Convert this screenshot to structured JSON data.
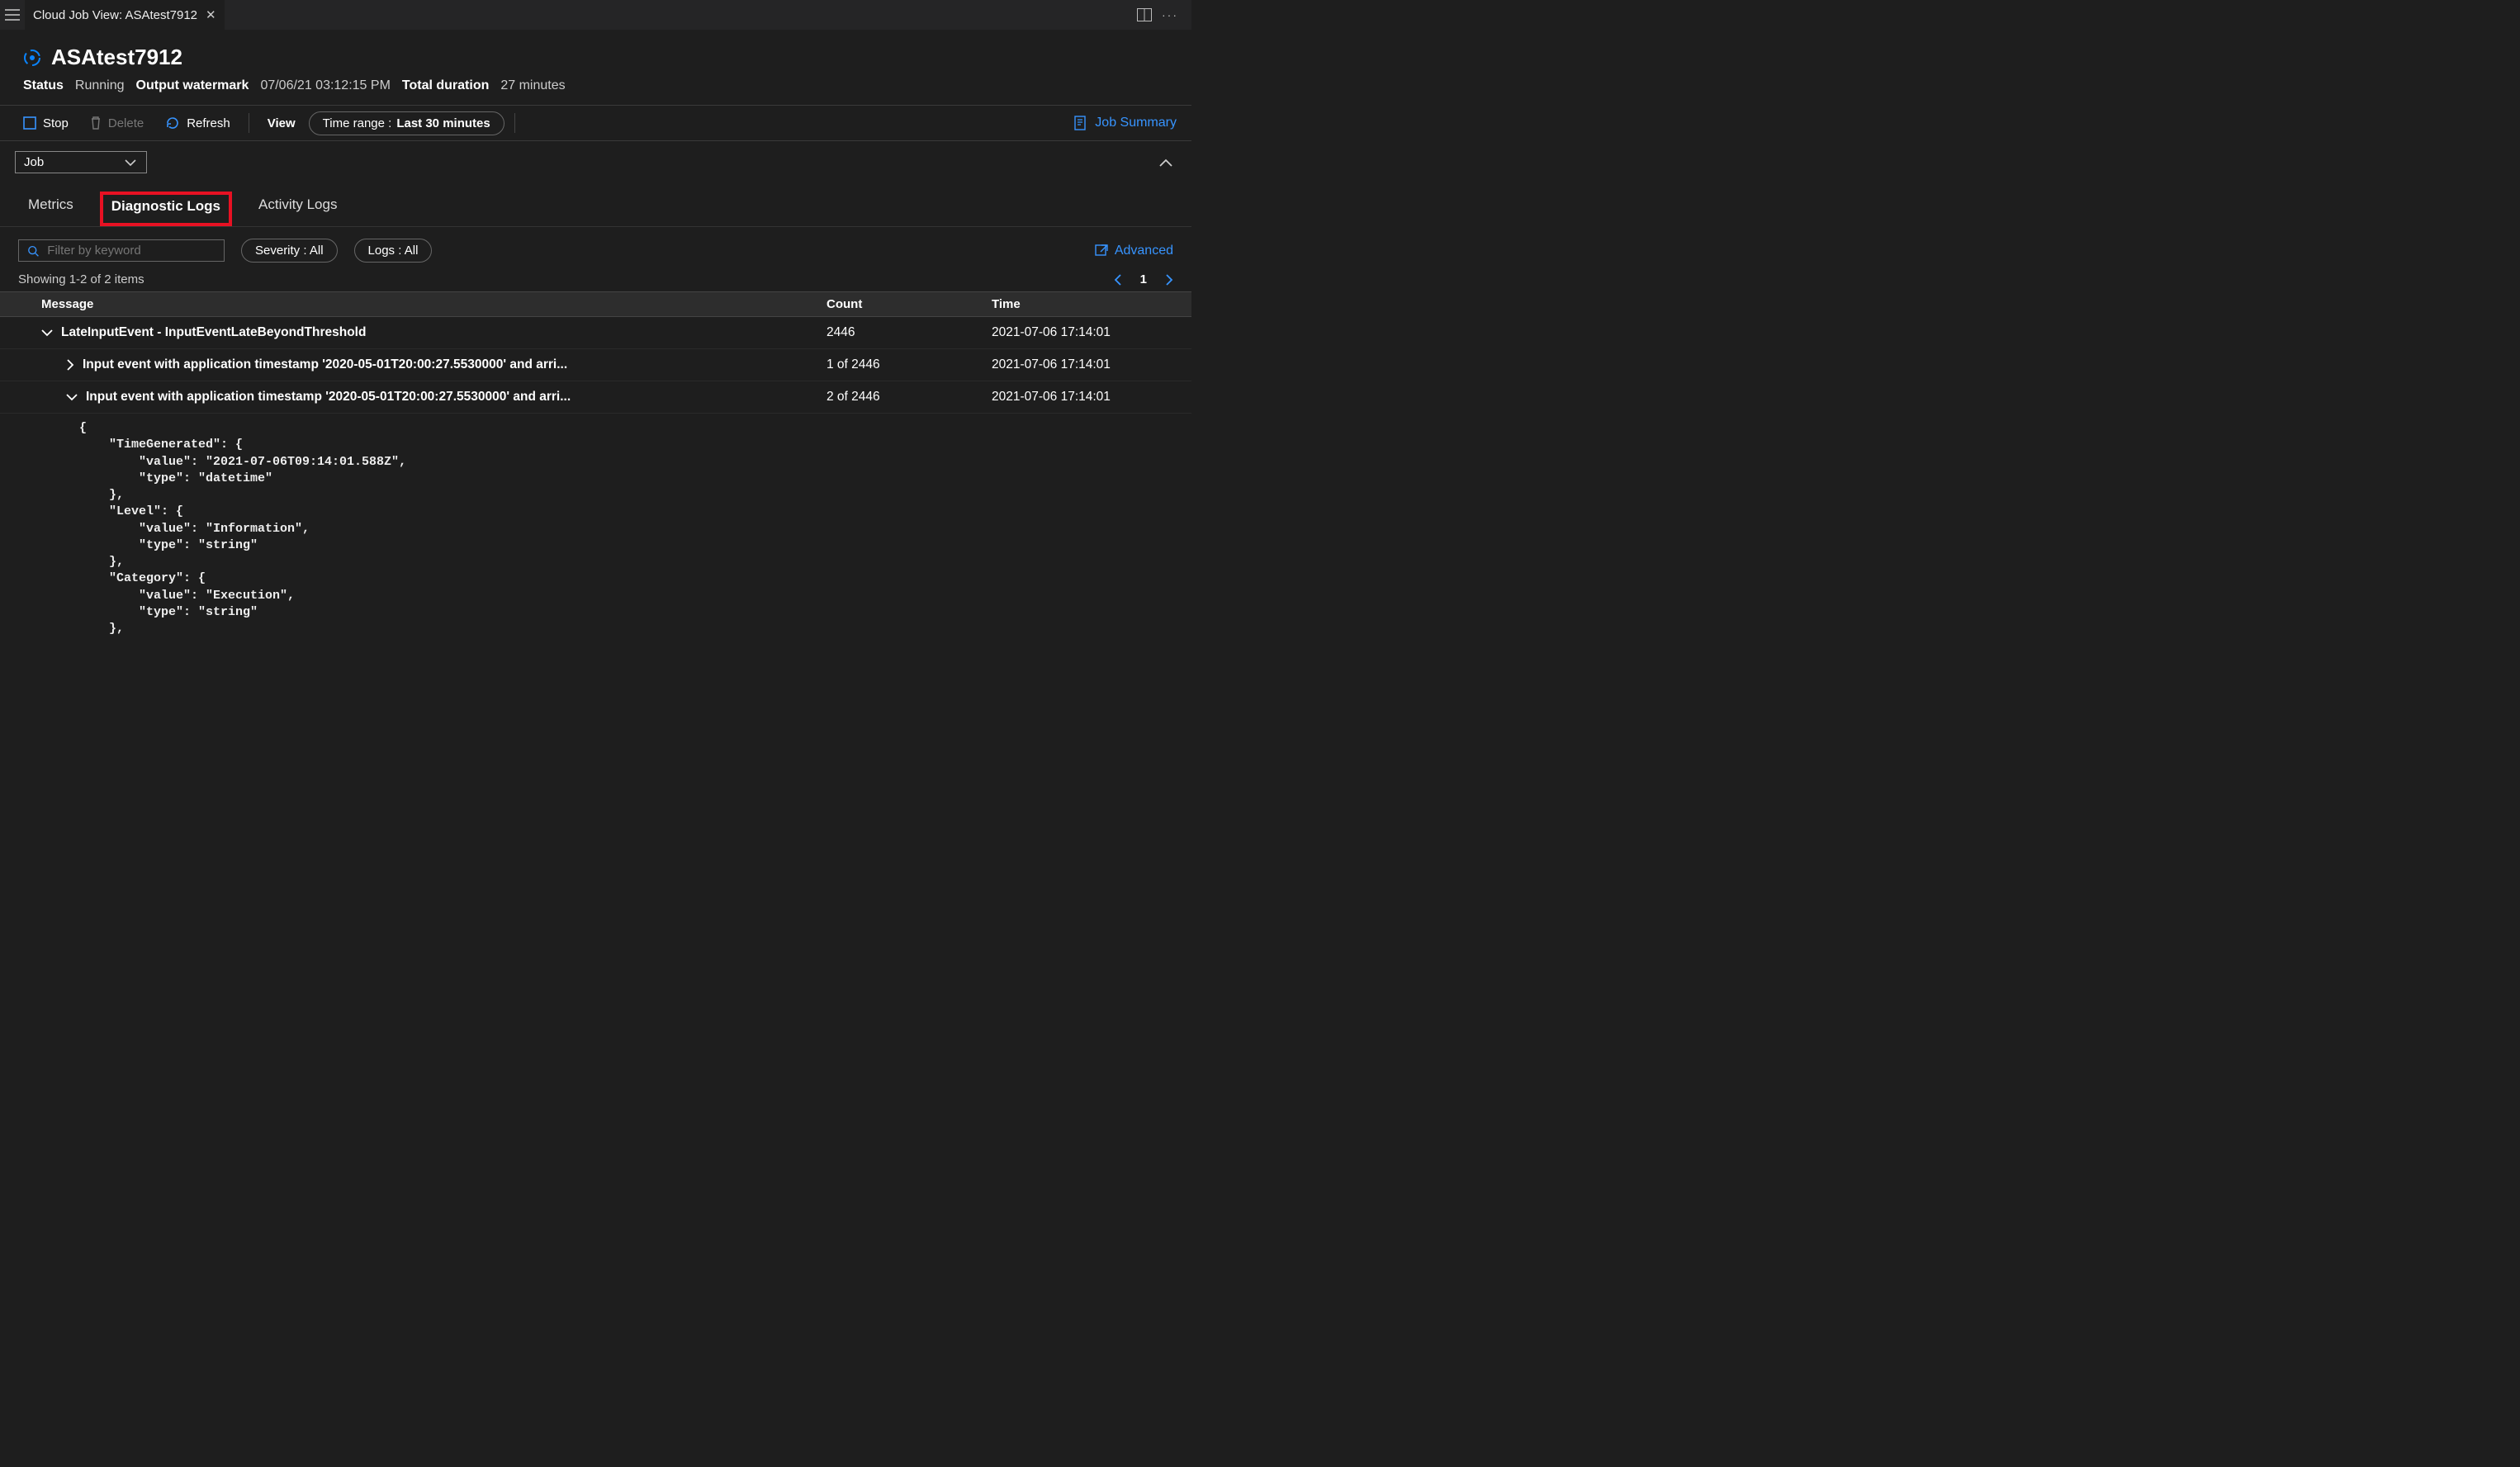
{
  "tab": {
    "title": "Cloud Job View: ASAtest7912"
  },
  "header": {
    "title": "ASAtest7912",
    "status_label": "Status",
    "status_value": "Running",
    "watermark_label": "Output watermark",
    "watermark_value": "07/06/21 03:12:15 PM",
    "duration_label": "Total duration",
    "duration_value": "27 minutes"
  },
  "toolbar": {
    "stop": "Stop",
    "delete": "Delete",
    "refresh": "Refresh",
    "view": "View",
    "timerange_label": "Time range :",
    "timerange_value": "Last 30 minutes",
    "summary": "Job Summary"
  },
  "jobselect": {
    "value": "Job"
  },
  "subtabs": {
    "metrics": "Metrics",
    "diag": "Diagnostic Logs",
    "activity": "Activity Logs"
  },
  "filters": {
    "search_placeholder": "Filter by keyword",
    "severity": "Severity : All",
    "logs": "Logs : All",
    "advanced": "Advanced"
  },
  "results": {
    "showing": "Showing 1-2 of 2 items",
    "page": "1"
  },
  "columns": {
    "message": "Message",
    "count": "Count",
    "time": "Time"
  },
  "rows": {
    "r0": {
      "msg": "LateInputEvent - InputEventLateBeyondThreshold",
      "count": "2446",
      "time": "2021-07-06 17:14:01"
    },
    "r1": {
      "msg": "Input event with application timestamp '2020-05-01T20:00:27.5530000' and arri...",
      "count": "1 of 2446",
      "time": "2021-07-06 17:14:01"
    },
    "r2": {
      "msg": "Input event with application timestamp '2020-05-01T20:00:27.5530000' and arri...",
      "count": "2 of 2446",
      "time": "2021-07-06 17:14:01"
    }
  },
  "json_detail": "{\n    \"TimeGenerated\": {\n        \"value\": \"2021-07-06T09:14:01.588Z\",\n        \"type\": \"datetime\"\n    },\n    \"Level\": {\n        \"value\": \"Information\",\n        \"type\": \"string\"\n    },\n    \"Category\": {\n        \"value\": \"Execution\",\n        \"type\": \"string\"\n    },"
}
